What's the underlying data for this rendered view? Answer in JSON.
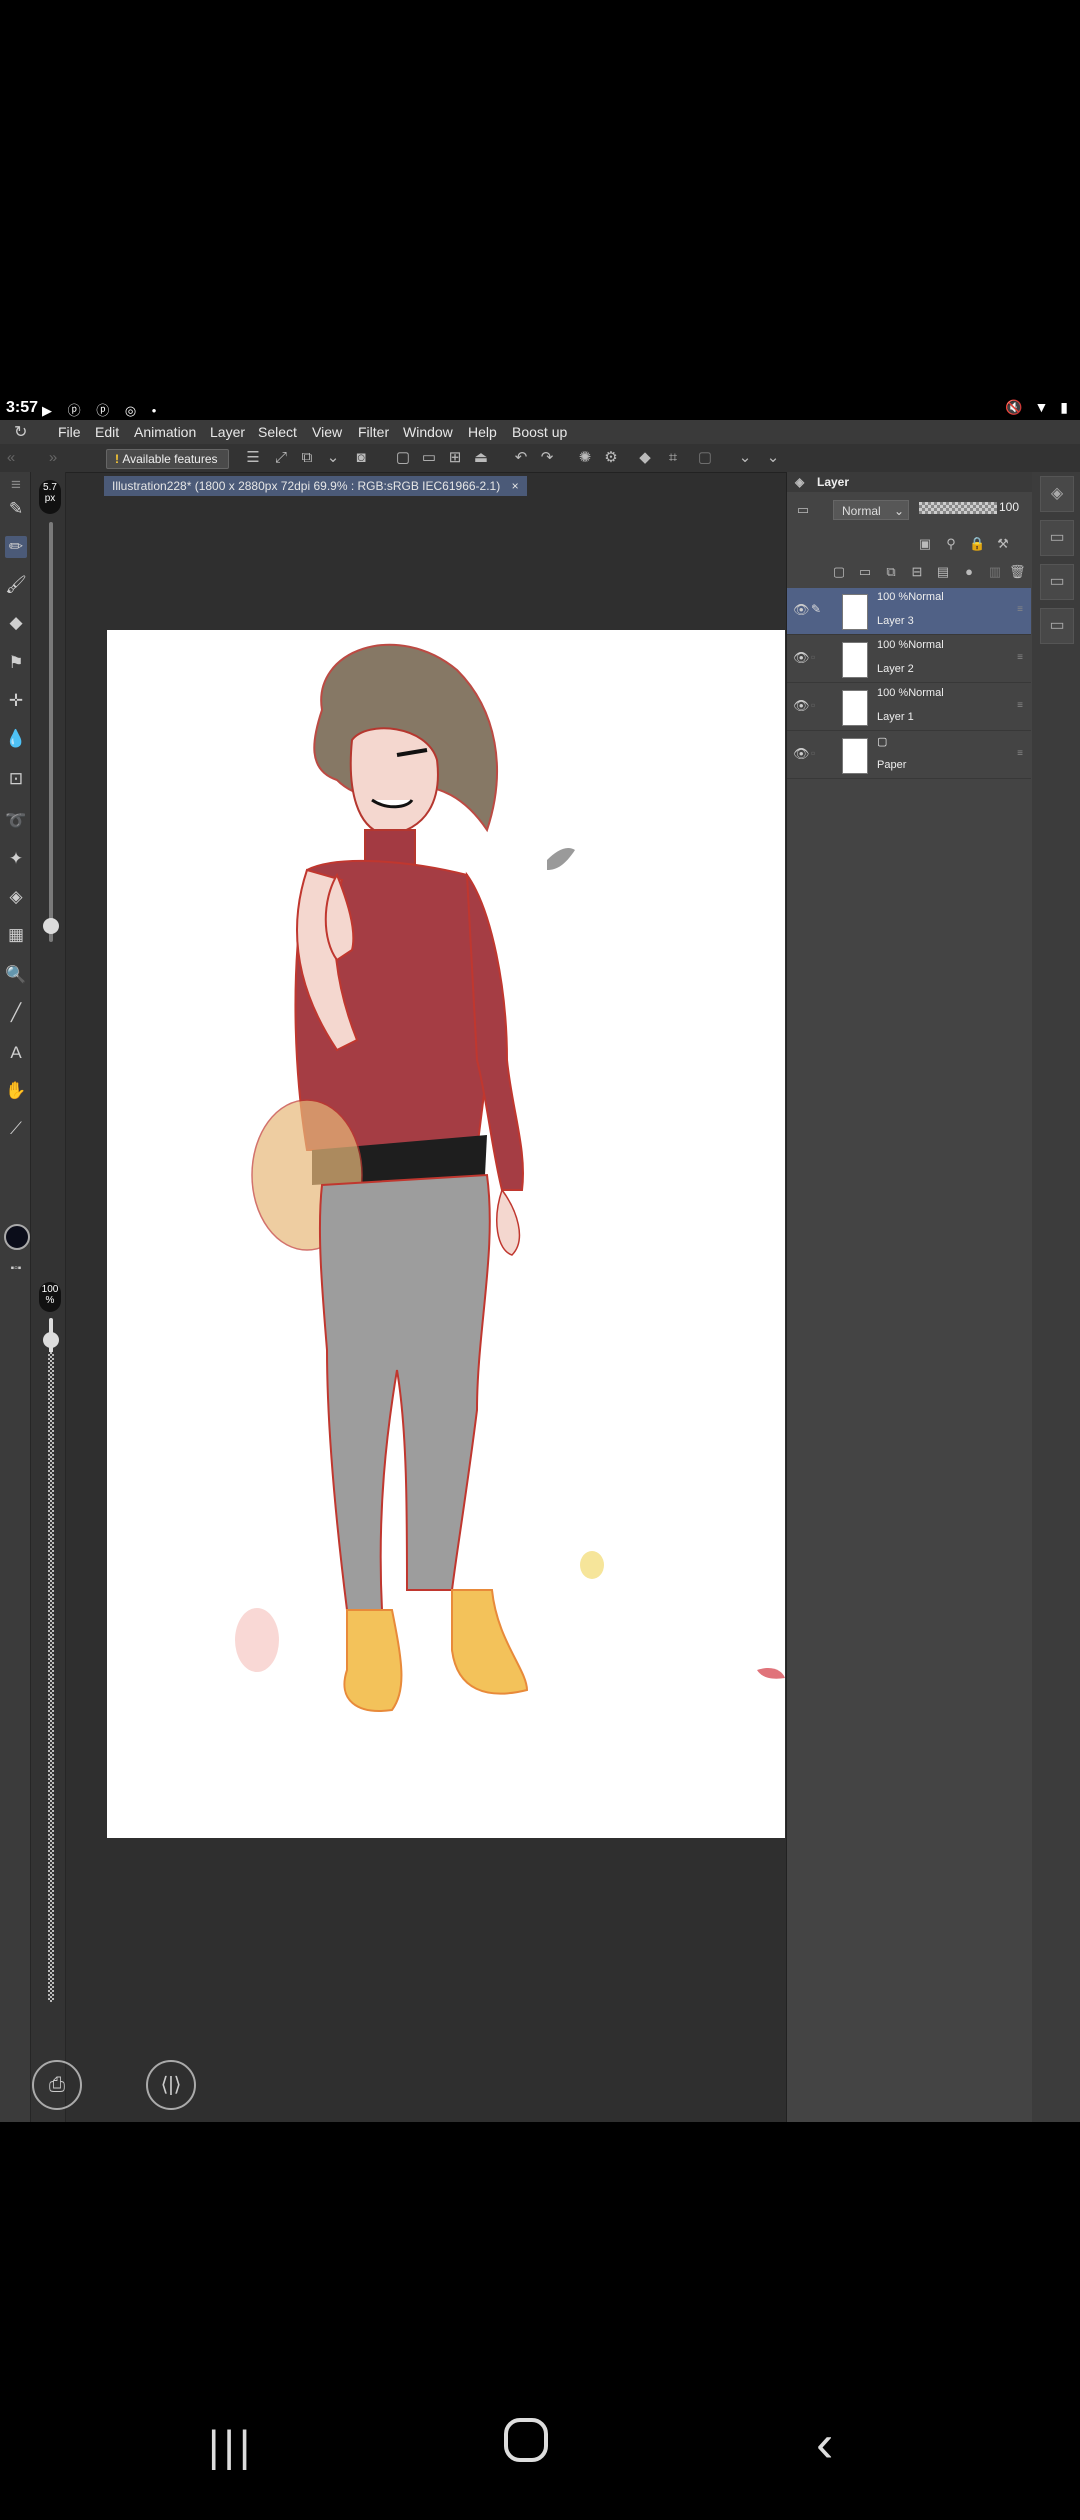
{
  "status_bar": {
    "time": "3:57"
  },
  "menu": {
    "items": [
      "File",
      "Edit",
      "Animation",
      "Layer",
      "Select",
      "View",
      "Filter",
      "Window",
      "Help",
      "Boost up"
    ]
  },
  "command_bar": {
    "available_features": "Available features"
  },
  "document_tab": {
    "title": "Illustration228* (1800 x 2880px 72dpi 69.9% : RGB:sRGB IEC61966-2.1)"
  },
  "brush": {
    "size_value": "5.7",
    "size_unit": "px",
    "opacity_value": "100",
    "opacity_unit": "%"
  },
  "color": {
    "main": "#0b0d1a"
  },
  "layer_panel": {
    "title": "Layer",
    "blend_mode": "Normal",
    "opacity": "100",
    "layers": [
      {
        "mode": "100 %Normal",
        "name": "Layer 3",
        "selected": true
      },
      {
        "mode": "100 %Normal",
        "name": "Layer 2",
        "selected": false
      },
      {
        "mode": "100 %Normal",
        "name": "Layer 1",
        "selected": false
      },
      {
        "mode": "",
        "name": "Paper",
        "selected": false
      }
    ]
  },
  "accent": "#4b5a78"
}
